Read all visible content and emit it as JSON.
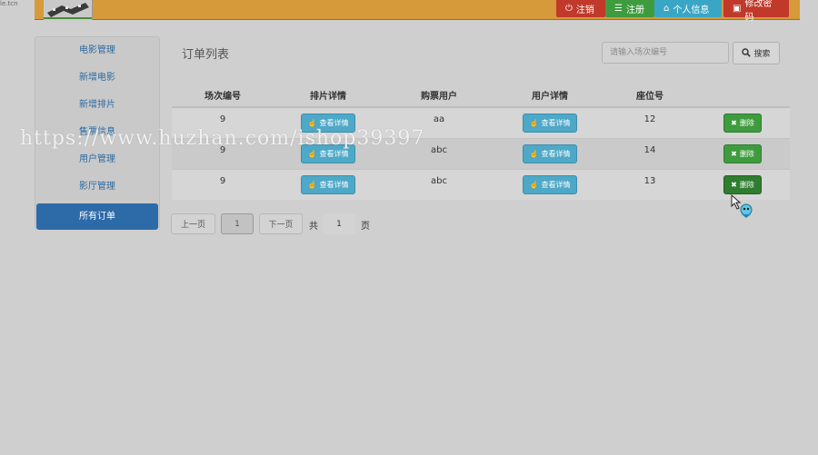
{
  "corner_text": "le.tcn",
  "topbar": {
    "logout": "注销",
    "register": "注册",
    "profile": "个人信息",
    "change_password": "修改密码"
  },
  "sidebar": {
    "items": [
      {
        "label": "电影管理"
      },
      {
        "label": "新增电影"
      },
      {
        "label": "新增排片"
      },
      {
        "label": "售票信息"
      },
      {
        "label": "用户管理"
      },
      {
        "label": "影厅管理"
      },
      {
        "label": "所有订单"
      }
    ],
    "active_index": 6
  },
  "main": {
    "title": "订单列表",
    "search": {
      "placeholder": "请输入场次编号",
      "button_label": "搜索"
    },
    "columns": [
      "场次编号",
      "排片详情",
      "购票用户",
      "用户详情",
      "座位号",
      ""
    ],
    "rows": [
      {
        "session": "9",
        "schedule_detail": "查看详情",
        "user": "aa",
        "user_detail": "查看详情",
        "seat": "12",
        "delete": "删除"
      },
      {
        "session": "9",
        "schedule_detail": "查看详情",
        "user": "abc",
        "user_detail": "查看详情",
        "seat": "14",
        "delete": "删除"
      },
      {
        "session": "9",
        "schedule_detail": "查看详情",
        "user": "abc",
        "user_detail": "查看详情",
        "seat": "13",
        "delete": "删除"
      }
    ],
    "pagination": {
      "prev": "上一页",
      "current": "1",
      "next": "下一页",
      "total_prefix": "共",
      "total": "1",
      "total_suffix": "页"
    }
  },
  "watermark": "https://www.huzhan.com/ishop39397",
  "colors": {
    "header": "#d69a3a",
    "sidebar_active": "#2d6aa8",
    "detail_button": "#4ea8c7",
    "delete_button": "#3e9b3e",
    "danger": "#c0392b"
  }
}
